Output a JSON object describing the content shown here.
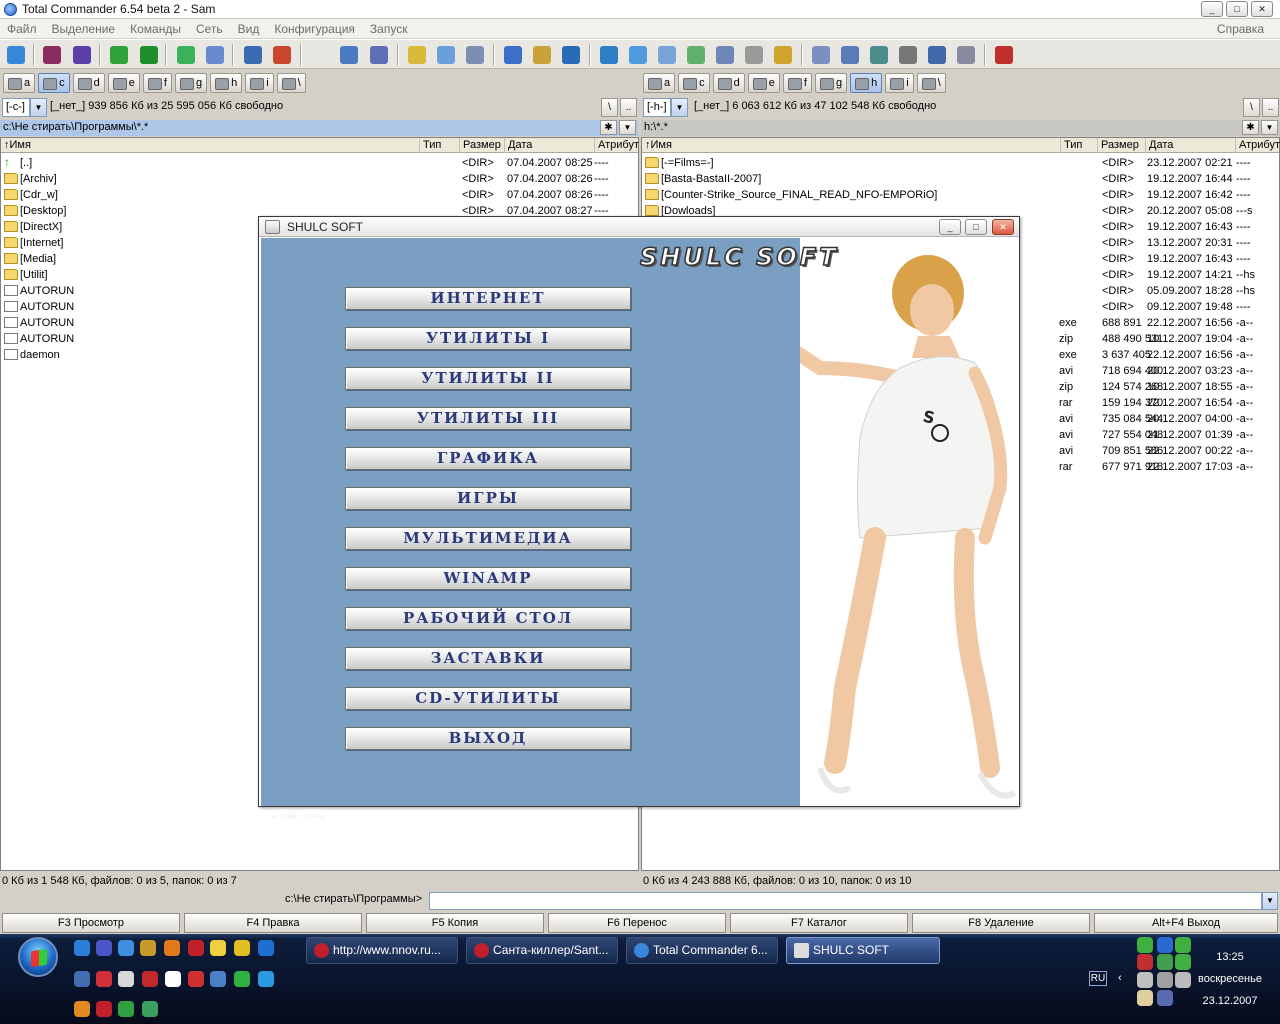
{
  "window": {
    "title": "Total Commander 6.54 beta 2 - Sam",
    "min": "_",
    "max": "□",
    "close": "✕"
  },
  "menu": {
    "items": [
      "Файл",
      "Выделение",
      "Команды",
      "Сеть",
      "Вид",
      "Конфигурация",
      "Запуск"
    ],
    "help": "Справка"
  },
  "left": {
    "drives": [
      "a",
      "c",
      "d",
      "e",
      "f",
      "g",
      "h",
      "i",
      "\\"
    ],
    "drive_combo": "[-c-]",
    "free": "[_нет_]  939 856 Кб из 25 595 056 Кб свободно",
    "path": "c:\\Не стирать\\Программы\\*.*",
    "columns": [
      "↑Имя",
      "Тип",
      "Размер",
      "Дата",
      "Атрибут"
    ],
    "rows": [
      {
        "name": "[..]",
        "type": "",
        "size": "<DIR>",
        "date": "07.04.2007 08:25",
        "attr": "----",
        "kind": "up"
      },
      {
        "name": "[Archiv]",
        "type": "",
        "size": "<DIR>",
        "date": "07.04.2007 08:26",
        "attr": "----",
        "kind": "folder"
      },
      {
        "name": "[Cdr_w]",
        "type": "",
        "size": "<DIR>",
        "date": "07.04.2007 08:26",
        "attr": "----",
        "kind": "folder"
      },
      {
        "name": "[Desktop]",
        "type": "",
        "size": "<DIR>",
        "date": "07.04.2007 08:27",
        "attr": "----",
        "kind": "folder"
      },
      {
        "name": "[DirectX]",
        "type": "",
        "size": "",
        "date": "",
        "attr": "",
        "kind": "folder"
      },
      {
        "name": "[Internet]",
        "type": "",
        "size": "",
        "date": "",
        "attr": "",
        "kind": "folder"
      },
      {
        "name": "[Media]",
        "type": "",
        "size": "",
        "date": "",
        "attr": "",
        "kind": "folder"
      },
      {
        "name": "[Utilit]",
        "type": "",
        "size": "",
        "date": "",
        "attr": "",
        "kind": "folder"
      },
      {
        "name": "AUTORUN",
        "type": "",
        "size": "",
        "date": "",
        "attr": "",
        "kind": "file"
      },
      {
        "name": "AUTORUN",
        "type": "",
        "size": "",
        "date": "",
        "attr": "",
        "kind": "file"
      },
      {
        "name": "AUTORUN",
        "type": "",
        "size": "",
        "date": "",
        "attr": "",
        "kind": "file"
      },
      {
        "name": "AUTORUN",
        "type": "",
        "size": "",
        "date": "",
        "attr": "",
        "kind": "file"
      },
      {
        "name": "daemon",
        "type": "",
        "size": "",
        "date": "",
        "attr": "",
        "kind": "file"
      }
    ],
    "status": "0 Кб из 1 548 Кб, файлов: 0 из 5, папок: 0 из 7"
  },
  "right": {
    "drives": [
      "a",
      "c",
      "d",
      "e",
      "f",
      "g",
      "h",
      "i",
      "\\"
    ],
    "drive_combo": "[-h-]",
    "free": "[_нет_]  6 063 612 Кб из 47 102 548 Кб свободно",
    "path": "h:\\*.*",
    "columns": [
      "↑Имя",
      "Тип",
      "Размер",
      "Дата",
      "Атрибут"
    ],
    "rows": [
      {
        "name": "[-=Films=-]",
        "type": "",
        "size": "<DIR>",
        "date": "23.12.2007 02:21",
        "attr": "----",
        "kind": "folder"
      },
      {
        "name": "[Basta-BastaII-2007]",
        "type": "",
        "size": "<DIR>",
        "date": "19.12.2007 16:44",
        "attr": "----",
        "kind": "folder"
      },
      {
        "name": "[Counter-Strike_Source_FINAL_READ_NFO-EMPORiO]",
        "type": "",
        "size": "<DIR>",
        "date": "19.12.2007 16:42",
        "attr": "----",
        "kind": "folder"
      },
      {
        "name": "[Dowloads]",
        "type": "",
        "size": "<DIR>",
        "date": "20.12.2007 05:08",
        "attr": "---s",
        "kind": "folder"
      },
      {
        "name": "",
        "type": "",
        "size": "<DIR>",
        "date": "19.12.2007 16:43",
        "attr": "----",
        "kind": ""
      },
      {
        "name": "",
        "type": "",
        "size": "<DIR>",
        "date": "13.12.2007 20:31",
        "attr": "----",
        "kind": ""
      },
      {
        "name": "",
        "type": "",
        "size": "<DIR>",
        "date": "19.12.2007 16:43",
        "attr": "----",
        "kind": ""
      },
      {
        "name": "",
        "type": "",
        "size": "<DIR>",
        "date": "19.12.2007 14:21",
        "attr": "--hs",
        "kind": ""
      },
      {
        "name": "",
        "type": "",
        "size": "<DIR>",
        "date": "05.09.2007 18:28",
        "attr": "--hs",
        "kind": ""
      },
      {
        "name": "",
        "type": "",
        "size": "<DIR>",
        "date": "09.12.2007 19:48",
        "attr": "----",
        "kind": ""
      },
      {
        "name": "",
        "type": "exe",
        "size": "688 891",
        "date": "22.12.2007 16:56",
        "attr": "-a--",
        "kind": ""
      },
      {
        "name": "",
        "type": "zip",
        "size": "488 490 531",
        "date": "10.12.2007 19:04",
        "attr": "-a--",
        "kind": ""
      },
      {
        "name": "",
        "type": "exe",
        "size": "3 637 405",
        "date": "22.12.2007 16:56",
        "attr": "-a--",
        "kind": ""
      },
      {
        "name": "",
        "type": "avi",
        "size": "718 694 400",
        "date": "20.12.2007 03:23",
        "attr": "-a--",
        "kind": ""
      },
      {
        "name": "",
        "type": "zip",
        "size": "124 574 268",
        "date": "10.12.2007 18:55",
        "attr": "-a--",
        "kind": ""
      },
      {
        "name": "",
        "type": "rar",
        "size": "159 194 370",
        "date": "22.12.2007 16:54",
        "attr": "-a--",
        "kind": ""
      },
      {
        "name": "",
        "type": "avi",
        "size": "735 084 544",
        "date": "20.12.2007 04:00",
        "attr": "-a--",
        "kind": ""
      },
      {
        "name": "",
        "type": "avi",
        "size": "727 554 048",
        "date": "21.12.2007 01:39",
        "attr": "-a--",
        "kind": ""
      },
      {
        "name": "",
        "type": "avi",
        "size": "709 851 586",
        "date": "22.12.2007 00:22",
        "attr": "-a--",
        "kind": ""
      },
      {
        "name": "",
        "type": "rar",
        "size": "677 971 918",
        "date": "22.12.2007 17:03",
        "attr": "-a--",
        "kind": ""
      }
    ],
    "status": "0 Кб из 4 243 888 Кб, файлов: 0 из 10, папок: 0 из 10"
  },
  "cmd": {
    "label": "c:\\Не стирать\\Программы>",
    "value": ""
  },
  "fkeys": [
    "F3 Просмотр",
    "F4 Правка",
    "F5 Копия",
    "F6 Перенос",
    "F7 Каталог",
    "F8 Удаление",
    "Alt+F4 Выход"
  ],
  "shulc": {
    "title": "SHULC SOFT",
    "logo": "SHULC SOFT",
    "buttons": [
      "ИНТЕРНЕТ",
      "УТИЛИТЫ I",
      "УТИЛИТЫ II",
      "УТИЛИТЫ III",
      "ГРАФИКА",
      "ИГРЫ",
      "МУЛЬТИМЕДИА",
      "WINAMP",
      "РАБОЧИЙ СТОЛ",
      "ЗАСТАВКИ",
      "CD-УТИЛИТЫ",
      "ВЫХОД"
    ],
    "footer": [
      "e-mail",
      "home"
    ]
  },
  "taskbar": {
    "tasks": [
      "http://www.nnov.ru...",
      "Санта-киллер/Sant...",
      "Total Commander 6...",
      "SHULC SOFT"
    ],
    "lang": "RU",
    "time": "13:25",
    "day": "воскресенье",
    "date": "23.12.2007"
  },
  "colors": {
    "shulc_panel": "#7a9fc2",
    "taskbar": "#0d1d3c",
    "button_text": "#2b3a7a"
  }
}
